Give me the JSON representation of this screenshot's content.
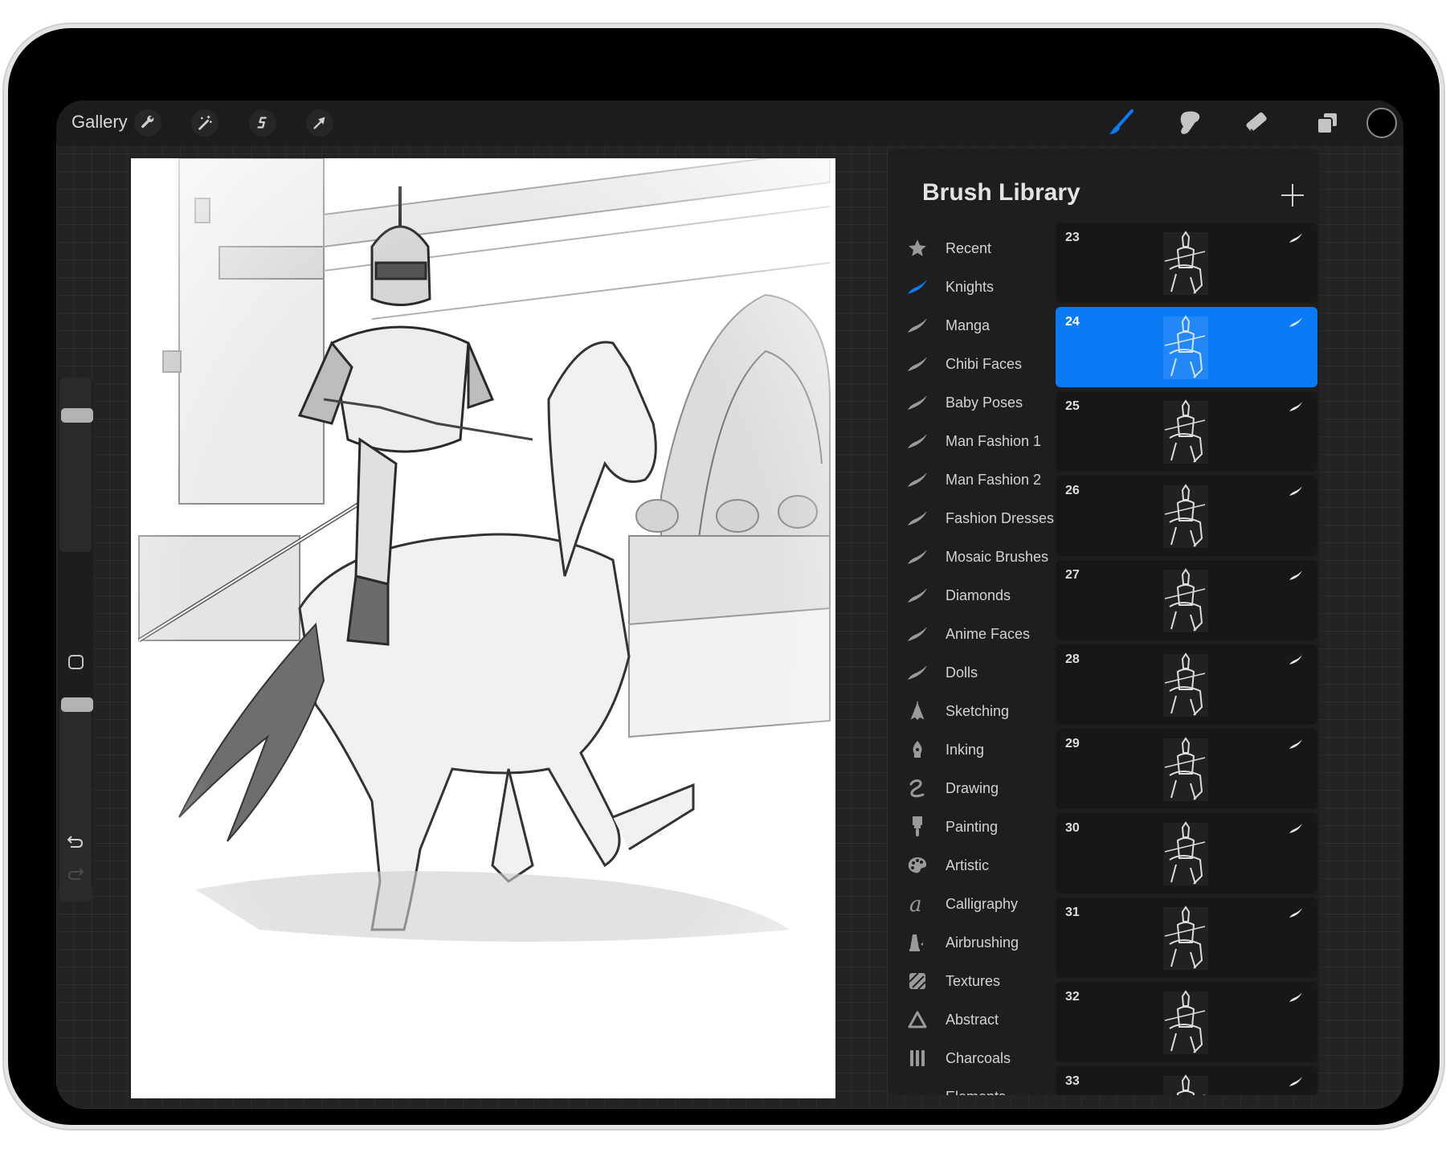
{
  "toolbar": {
    "gallery_label": "Gallery",
    "left_tools": [
      {
        "name": "actions",
        "icon": "wrench-icon"
      },
      {
        "name": "adjustments",
        "icon": "magic-wand-icon"
      },
      {
        "name": "selection",
        "icon": "selection-s-icon"
      },
      {
        "name": "transform",
        "icon": "arrow-cursor-icon"
      }
    ],
    "right_tools": [
      {
        "name": "brush",
        "icon": "paintbrush-icon",
        "active": true
      },
      {
        "name": "smudge",
        "icon": "smudge-finger-icon",
        "active": false
      },
      {
        "name": "eraser",
        "icon": "eraser-icon",
        "active": false
      },
      {
        "name": "layers",
        "icon": "layers-icon",
        "active": false
      }
    ],
    "current_color": "#000000",
    "accent_color": "#0a7af5"
  },
  "sidebar": {
    "brush_size_level": 0.9,
    "opacity_level": 1.0,
    "modify_button": "square-icon",
    "undo": "undo-icon",
    "redo": "redo-icon"
  },
  "canvas": {
    "artwork": "Pencil sketch of an armored knight riding a galloping horse through a castle courtyard with spectators"
  },
  "brush_library": {
    "title": "Brush Library",
    "add_icon": "plus-icon",
    "categories": [
      {
        "label": "Recent",
        "icon": "star-icon",
        "selected": false
      },
      {
        "label": "Knights",
        "icon": "brush-stroke-icon",
        "selected": true
      },
      {
        "label": "Manga",
        "icon": "brush-stroke-icon",
        "selected": false
      },
      {
        "label": "Chibi Faces",
        "icon": "brush-stroke-icon",
        "selected": false
      },
      {
        "label": "Baby Poses",
        "icon": "brush-stroke-icon",
        "selected": false
      },
      {
        "label": "Man Fashion 1",
        "icon": "brush-stroke-icon",
        "selected": false
      },
      {
        "label": "Man Fashion 2",
        "icon": "brush-stroke-icon",
        "selected": false
      },
      {
        "label": "Fashion Dresses",
        "icon": "brush-stroke-icon",
        "selected": false
      },
      {
        "label": "Mosaic Brushes",
        "icon": "brush-stroke-icon",
        "selected": false
      },
      {
        "label": "Diamonds",
        "icon": "brush-stroke-icon",
        "selected": false
      },
      {
        "label": "Anime Faces",
        "icon": "brush-stroke-icon",
        "selected": false
      },
      {
        "label": "Dolls",
        "icon": "brush-stroke-icon",
        "selected": false
      },
      {
        "label": "Sketching",
        "icon": "pencil-tip-icon",
        "selected": false
      },
      {
        "label": "Inking",
        "icon": "pen-nib-icon",
        "selected": false
      },
      {
        "label": "Drawing",
        "icon": "squiggle-icon",
        "selected": false
      },
      {
        "label": "Painting",
        "icon": "paint-brush-icon",
        "selected": false
      },
      {
        "label": "Artistic",
        "icon": "palette-icon",
        "selected": false
      },
      {
        "label": "Calligraphy",
        "icon": "calligraphy-a-icon",
        "selected": false
      },
      {
        "label": "Airbrushing",
        "icon": "airbrush-icon",
        "selected": false
      },
      {
        "label": "Textures",
        "icon": "hatched-square-icon",
        "selected": false
      },
      {
        "label": "Abstract",
        "icon": "triangle-icon",
        "selected": false
      },
      {
        "label": "Charcoals",
        "icon": "charcoal-bars-icon",
        "selected": false
      },
      {
        "label": "Elements",
        "icon": "eye-dome-icon",
        "selected": false
      }
    ],
    "brushes": [
      {
        "number": "23",
        "selected": false
      },
      {
        "number": "24",
        "selected": true
      },
      {
        "number": "25",
        "selected": false
      },
      {
        "number": "26",
        "selected": false
      },
      {
        "number": "27",
        "selected": false
      },
      {
        "number": "28",
        "selected": false
      },
      {
        "number": "29",
        "selected": false
      },
      {
        "number": "30",
        "selected": false
      },
      {
        "number": "31",
        "selected": false
      },
      {
        "number": "32",
        "selected": false
      },
      {
        "number": "33",
        "selected": false
      }
    ]
  }
}
